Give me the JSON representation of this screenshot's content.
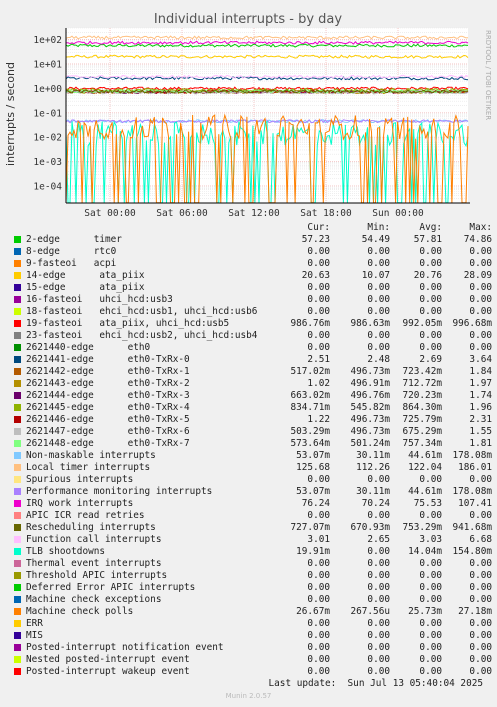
{
  "chart_data": {
    "type": "line",
    "title": "Individual interrupts - by day",
    "ylabel": "interrupts / second",
    "yscale": "log",
    "ylim": [
      2e-05,
      300
    ],
    "y_ticks": [
      "1e-04",
      "1e-03",
      "1e-02",
      "1e-01",
      "1e+00",
      "1e+01",
      "1e+02"
    ],
    "x_ticks": [
      "Sat 00:00",
      "Sat 06:00",
      "Sat 12:00",
      "Sat 18:00",
      "Sun 00:00"
    ],
    "grid": true,
    "side_label": "RRDTOOL / TOBI OETIKER",
    "columns": [
      "Cur:",
      "Min:",
      "Avg:",
      "Max:"
    ],
    "series": [
      {
        "name": "2-edge      timer",
        "color": "#00cc00",
        "cur": "57.23",
        "min": "54.49",
        "avg": "57.81",
        "max": "74.86",
        "level": 57
      },
      {
        "name": "8-edge      rtc0",
        "color": "#0066b3",
        "cur": "0.00",
        "min": "0.00",
        "avg": "0.00",
        "max": "0.00",
        "level": 0
      },
      {
        "name": "9-fasteoi   acpi",
        "color": "#ff8000",
        "cur": "0.00",
        "min": "0.00",
        "avg": "0.00",
        "max": "0.00",
        "level": 0
      },
      {
        "name": "14-edge      ata_piix",
        "color": "#ffcc00",
        "cur": "20.63",
        "min": "10.07",
        "avg": "20.76",
        "max": "28.09",
        "level": 20
      },
      {
        "name": "15-edge      ata_piix",
        "color": "#330099",
        "cur": "0.00",
        "min": "0.00",
        "avg": "0.00",
        "max": "0.00",
        "level": 0
      },
      {
        "name": "16-fasteoi   uhci_hcd:usb3",
        "color": "#990099",
        "cur": "0.00",
        "min": "0.00",
        "avg": "0.00",
        "max": "0.00",
        "level": 0
      },
      {
        "name": "18-fasteoi   ehci_hcd:usb1, uhci_hcd:usb6",
        "color": "#ccff00",
        "cur": "0.00",
        "min": "0.00",
        "avg": "0.00",
        "max": "0.00",
        "level": 0
      },
      {
        "name": "19-fasteoi   ata_piix, uhci_hcd:usb5",
        "color": "#ff0000",
        "cur": "986.76m",
        "min": "986.63m",
        "avg": "992.05m",
        "max": "996.68m",
        "level": 0.99
      },
      {
        "name": "23-fasteoi   ehci_hcd:usb2, uhci_hcd:usb4",
        "color": "#808080",
        "cur": "0.00",
        "min": "0.00",
        "avg": "0.00",
        "max": "0.00",
        "level": 0
      },
      {
        "name": "2621440-edge      eth0",
        "color": "#008f00",
        "cur": "0.00",
        "min": "0.00",
        "avg": "0.00",
        "max": "0.00",
        "level": 0
      },
      {
        "name": "2621441-edge      eth0-TxRx-0",
        "color": "#00487d",
        "cur": "2.51",
        "min": "2.48",
        "avg": "2.69",
        "max": "3.64",
        "level": 2.6
      },
      {
        "name": "2621442-edge      eth0-TxRx-1",
        "color": "#b35a00",
        "cur": "517.02m",
        "min": "496.73m",
        "avg": "723.42m",
        "max": "1.84",
        "level": 0.72
      },
      {
        "name": "2621443-edge      eth0-TxRx-2",
        "color": "#b38f00",
        "cur": "1.02",
        "min": "496.91m",
        "avg": "712.72m",
        "max": "1.97",
        "level": 0.71
      },
      {
        "name": "2621444-edge      eth0-TxRx-3",
        "color": "#6b006b",
        "cur": "663.02m",
        "min": "496.76m",
        "avg": "720.23m",
        "max": "1.74",
        "level": 0.72
      },
      {
        "name": "2621445-edge      eth0-TxRx-4",
        "color": "#8fb300",
        "cur": "834.71m",
        "min": "545.82m",
        "avg": "864.30m",
        "max": "1.96",
        "level": 0.86
      },
      {
        "name": "2621446-edge      eth0-TxRx-5",
        "color": "#b30000",
        "cur": "1.22",
        "min": "496.73m",
        "avg": "725.79m",
        "max": "2.31",
        "level": 0.73
      },
      {
        "name": "2621447-edge      eth0-TxRx-6",
        "color": "#bebebe",
        "cur": "503.29m",
        "min": "496.73m",
        "avg": "675.29m",
        "max": "1.55",
        "level": 0.68
      },
      {
        "name": "2621448-edge      eth0-TxRx-7",
        "color": "#80ff80",
        "cur": "573.64m",
        "min": "501.24m",
        "avg": "757.34m",
        "max": "1.81",
        "level": 0.76
      },
      {
        "name": "Non-maskable interrupts",
        "color": "#80c9ff",
        "cur": "53.07m",
        "min": "30.11m",
        "avg": "44.61m",
        "max": "178.08m",
        "level": 0.045
      },
      {
        "name": "Local timer interrupts",
        "color": "#ffc080",
        "cur": "125.68",
        "min": "112.26",
        "avg": "122.04",
        "max": "186.01",
        "level": 122
      },
      {
        "name": "Spurious interrupts",
        "color": "#ffe680",
        "cur": "0.00",
        "min": "0.00",
        "avg": "0.00",
        "max": "0.00",
        "level": 0
      },
      {
        "name": "Performance monitoring interrupts",
        "color": "#aa80ff",
        "cur": "53.07m",
        "min": "30.11m",
        "avg": "44.61m",
        "max": "178.08m",
        "level": 0.045
      },
      {
        "name": "IRQ work interrupts",
        "color": "#ee00cc",
        "cur": "76.24",
        "min": "70.24",
        "avg": "75.53",
        "max": "107.41",
        "level": 75
      },
      {
        "name": "APIC ICR read retries",
        "color": "#ff8080",
        "cur": "0.00",
        "min": "0.00",
        "avg": "0.00",
        "max": "0.00",
        "level": 0
      },
      {
        "name": "Rescheduling interrupts",
        "color": "#666600",
        "cur": "727.07m",
        "min": "670.93m",
        "avg": "753.29m",
        "max": "941.68m",
        "level": 0.75
      },
      {
        "name": "Function call interrupts",
        "color": "#ffbfff",
        "cur": "3.01",
        "min": "2.65",
        "avg": "3.03",
        "max": "6.68",
        "level": 3.0
      },
      {
        "name": "TLB shootdowns",
        "color": "#00ffcc",
        "cur": "19.91m",
        "min": "0.00",
        "avg": "14.04m",
        "max": "154.80m",
        "level": 0.014
      },
      {
        "name": "Thermal event interrupts",
        "color": "#cc6699",
        "cur": "0.00",
        "min": "0.00",
        "avg": "0.00",
        "max": "0.00",
        "level": 0
      },
      {
        "name": "Threshold APIC interrupts",
        "color": "#999900",
        "cur": "0.00",
        "min": "0.00",
        "avg": "0.00",
        "max": "0.00",
        "level": 0
      },
      {
        "name": "Deferred Error APIC interrupts",
        "color": "#00cc00",
        "cur": "0.00",
        "min": "0.00",
        "avg": "0.00",
        "max": "0.00",
        "level": 0
      },
      {
        "name": "Machine check exceptions",
        "color": "#0066b3",
        "cur": "0.00",
        "min": "0.00",
        "avg": "0.00",
        "max": "0.00",
        "level": 0
      },
      {
        "name": "Machine check polls",
        "color": "#ff8000",
        "cur": "26.67m",
        "min": "267.56u",
        "avg": "25.73m",
        "max": "27.18m",
        "level": 0.026
      },
      {
        "name": "ERR",
        "color": "#ffcc00",
        "cur": "0.00",
        "min": "0.00",
        "avg": "0.00",
        "max": "0.00",
        "level": 0
      },
      {
        "name": "MIS",
        "color": "#330099",
        "cur": "0.00",
        "min": "0.00",
        "avg": "0.00",
        "max": "0.00",
        "level": 0
      },
      {
        "name": "Posted-interrupt notification event",
        "color": "#990099",
        "cur": "0.00",
        "min": "0.00",
        "avg": "0.00",
        "max": "0.00",
        "level": 0
      },
      {
        "name": "Nested posted-interrupt event",
        "color": "#ccff00",
        "cur": "0.00",
        "min": "0.00",
        "avg": "0.00",
        "max": "0.00",
        "level": 0
      },
      {
        "name": "Posted-interrupt wakeup event",
        "color": "#ff0000",
        "cur": "0.00",
        "min": "0.00",
        "avg": "0.00",
        "max": "0.00",
        "level": 0
      }
    ]
  },
  "last_update": "Last update:  Sun Jul 13 05:40:04 2025",
  "footer": "Munin 2.0.57"
}
